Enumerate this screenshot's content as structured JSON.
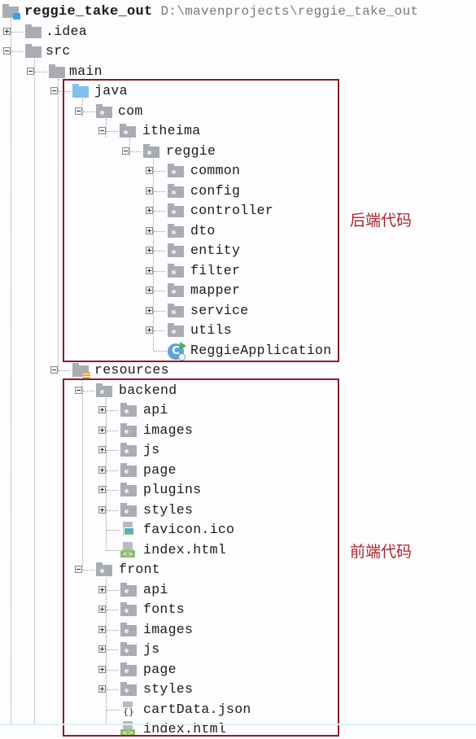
{
  "project": {
    "name": "reggie_take_out",
    "path": "D:\\mavenprojects\\reggie_take_out"
  },
  "tree": {
    "idea": ".idea",
    "src": "src",
    "main": "main",
    "java": "java",
    "com": "com",
    "itheima": "itheima",
    "reggie": "reggie",
    "reggie_children": [
      "common",
      "config",
      "controller",
      "dto",
      "entity",
      "filter",
      "mapper",
      "service",
      "utils"
    ],
    "app_class": "ReggieApplication",
    "resources": "resources",
    "backend": {
      "name": "backend",
      "folders": [
        "api",
        "images",
        "js",
        "page",
        "plugins",
        "styles"
      ],
      "files": [
        "favicon.ico",
        "index.html"
      ]
    },
    "front": {
      "name": "front",
      "folders": [
        "api",
        "fonts",
        "images",
        "js",
        "page",
        "styles"
      ],
      "files": [
        "cartData.json",
        "index.html"
      ]
    }
  },
  "annotations": {
    "backend_code": "后端代码",
    "frontend_code": "前端代码",
    "box_color": "#8b1f24",
    "label_color": "#a5262b"
  },
  "colors": {
    "folder": "#a9acb3",
    "source_folder": "#82c0ee"
  }
}
